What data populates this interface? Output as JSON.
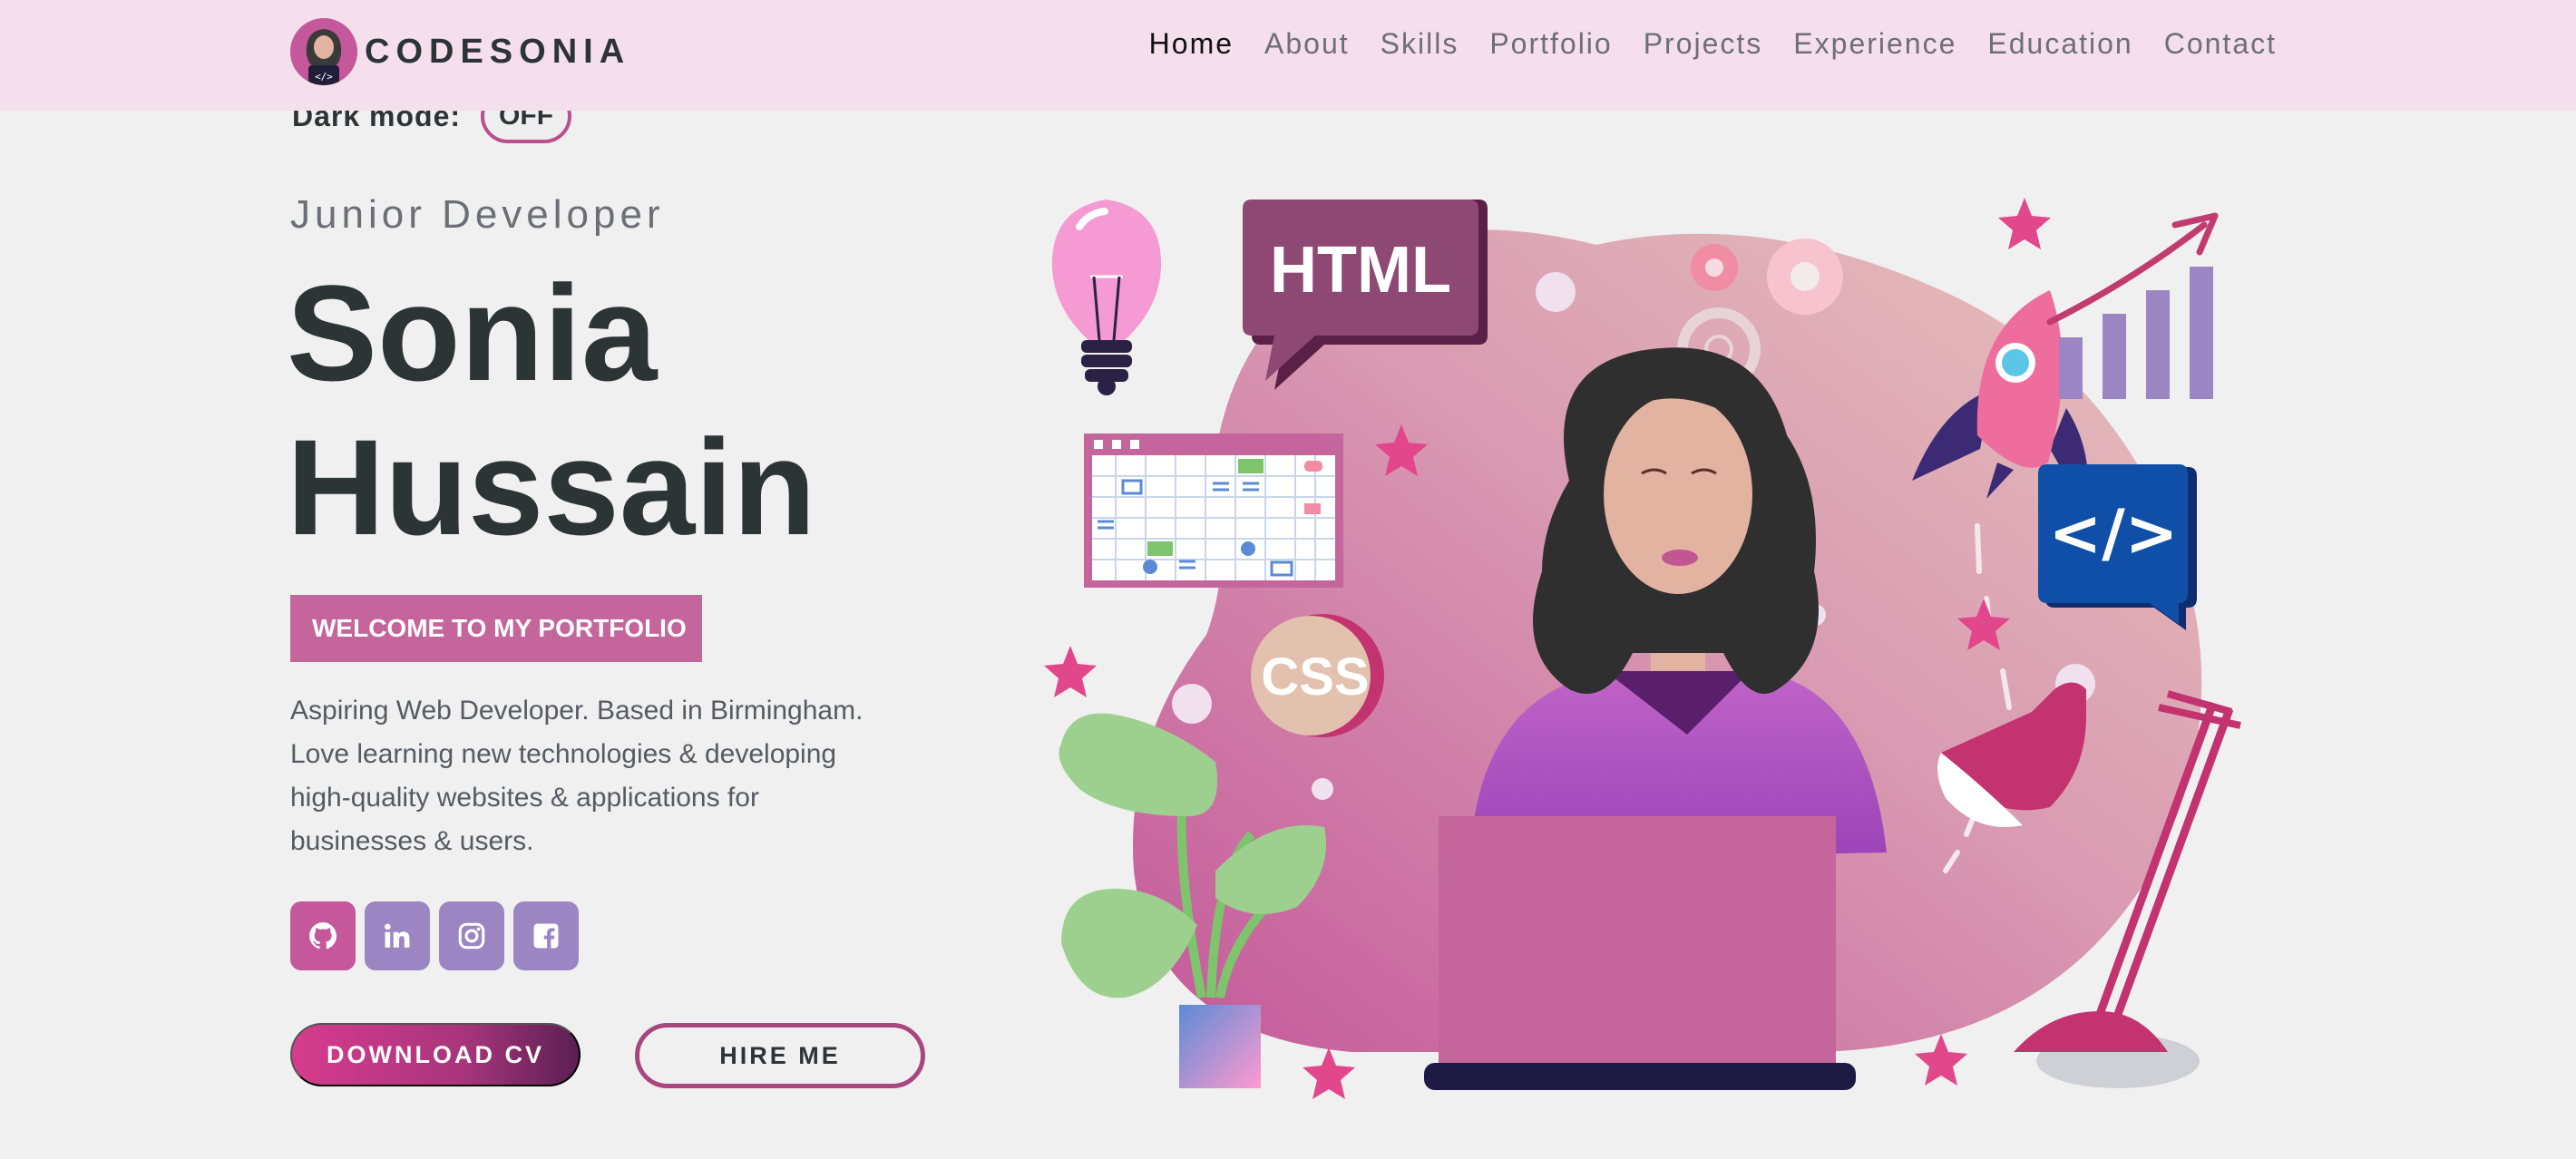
{
  "brand": {
    "name": "CODESONIA"
  },
  "nav": {
    "links": [
      "Home",
      "About",
      "Skills",
      "Portfolio",
      "Projects",
      "Experience",
      "Education",
      "Contact"
    ],
    "active": "Home"
  },
  "dark_mode": {
    "label": "Dark mode:",
    "state": "OFF"
  },
  "hero": {
    "role": "Junior Developer",
    "first_name": "Sonia",
    "last_name": "Hussain",
    "welcome": "WELCOME TO MY PORTFOLIO",
    "bio_lines": [
      "Aspiring Web Developer. Based in Birmingham.",
      "Love learning new technologies & developing",
      "high-quality websites & applications for",
      "businesses & users."
    ],
    "download_cv": "DOWNLOAD CV",
    "hire_me": "HIRE ME"
  },
  "socials": [
    {
      "icon": "github-icon"
    },
    {
      "icon": "linkedin-icon"
    },
    {
      "icon": "instagram-icon"
    },
    {
      "icon": "facebook-icon"
    }
  ],
  "illustration": {
    "html_bubble": "HTML",
    "css_badge": "CSS",
    "code_bubble": "</>"
  },
  "colors": {
    "accent": "#c4589a",
    "purple": "#9b86c3",
    "nav_bg": "#f5dfec",
    "page_bg": "#f0f0f0"
  }
}
